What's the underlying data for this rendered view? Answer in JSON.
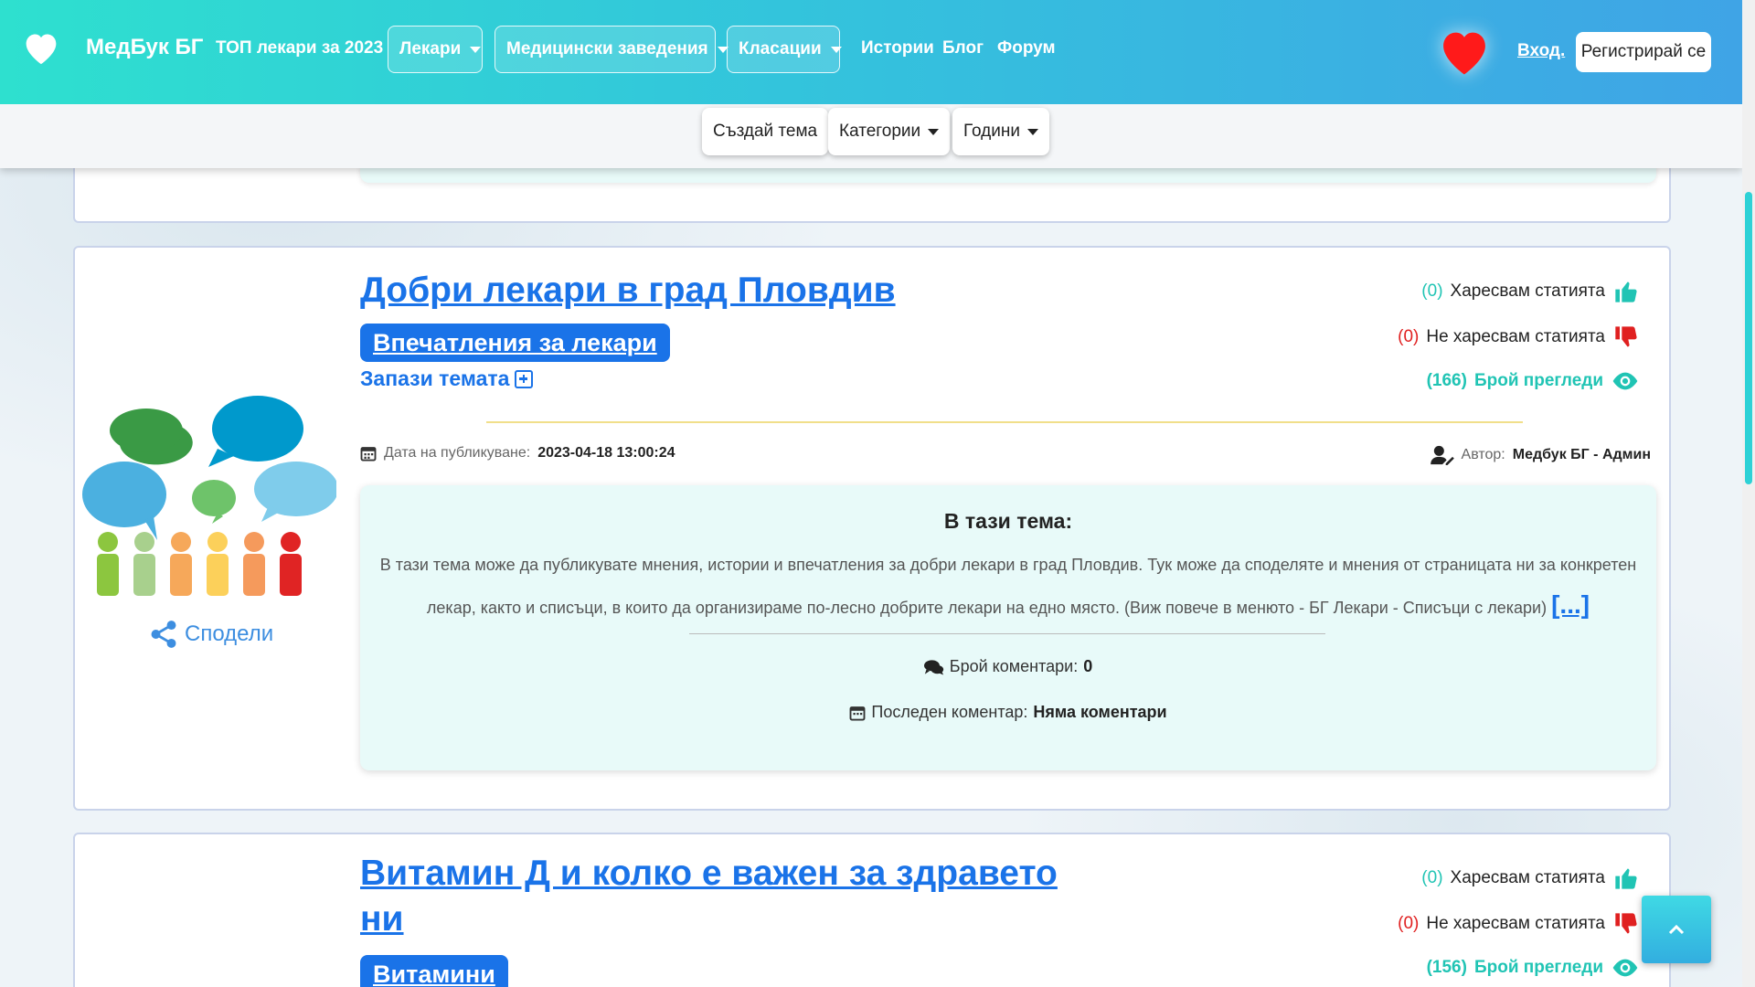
{
  "navbar": {
    "brand": "МедБук БГ",
    "top_link": "ТОП лекари за 2023",
    "dropdowns": [
      "Лекари",
      "Медицински заведения",
      "Класации"
    ],
    "links": [
      "Истории",
      "Блог",
      "Форум"
    ],
    "login": "Вход.",
    "register": "Регистрирай се",
    "icons": {
      "logo": "heart-icon",
      "favorite": "heart-icon"
    }
  },
  "subbar": {
    "create": "Създай тема",
    "categories": "Категории",
    "years": "Години"
  },
  "post1": {
    "title": "Добри лекари в град Пловдив",
    "category": "Впечатления за лекари",
    "save": "Запази темата",
    "likes_count": "(0)",
    "likes_label": "Харесвам статията",
    "dislikes_count": "(0)",
    "dislikes_label": "Не харесвам статията",
    "views_count": "(166)",
    "views_label": "Брой прегледи",
    "date_label": "Дата на публикуване:",
    "date_value": "2023-04-18 13:00:24",
    "author_label": "Автор:",
    "author_value": "Медбук БГ - Админ",
    "inner_heading": "В тази тема:",
    "inner_text": "В тази тема може да публикувате мнения, истории и впечатления за добри лекари в град Пловдив. Тук може да споделяте и мнения от страницата ни за конкретен лекар, както и списъци, в които да организираме по-лесно добрите лекари на едно място. (Виж повече в менюто - БГ Лекари - Списъци с лекари)",
    "more": "[...]",
    "comments_label": "Брой коментари:",
    "comments_value": "0",
    "last_comment_label": "Последен коментар:",
    "last_comment_value": "Няма коментари",
    "share": "Сподели"
  },
  "post2": {
    "title_line1": "Витамин Д и колко е важен за здравето",
    "title_line2": "ни",
    "category": "Витамини",
    "likes_count": "(0)",
    "likes_label": "Харесвам статията",
    "dislikes_count": "(0)",
    "dislikes_label": "Не харесвам статията",
    "views_count": "(156)",
    "views_label": "Брой прегледи"
  },
  "colors": {
    "accent": "#1a73e8",
    "teal": "#20c4b4",
    "red": "#e02020"
  }
}
